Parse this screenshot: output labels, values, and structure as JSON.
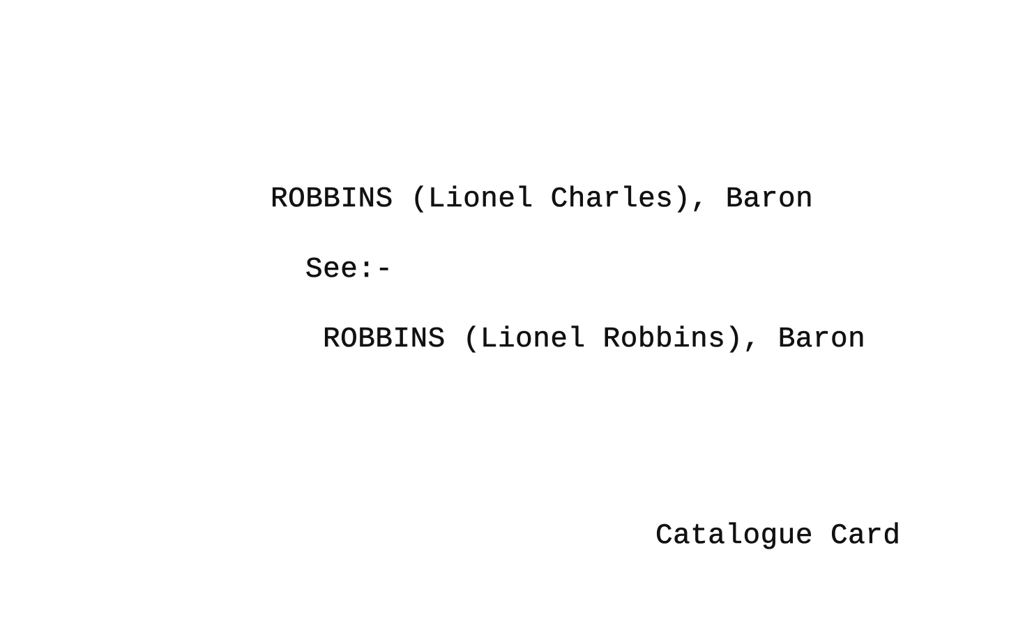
{
  "card": {
    "heading": "ROBBINS (Lionel Charles), Baron",
    "see_label": "See:-",
    "reference": "ROBBINS (Lionel Robbins), Baron",
    "footer": "Catalogue Card"
  }
}
